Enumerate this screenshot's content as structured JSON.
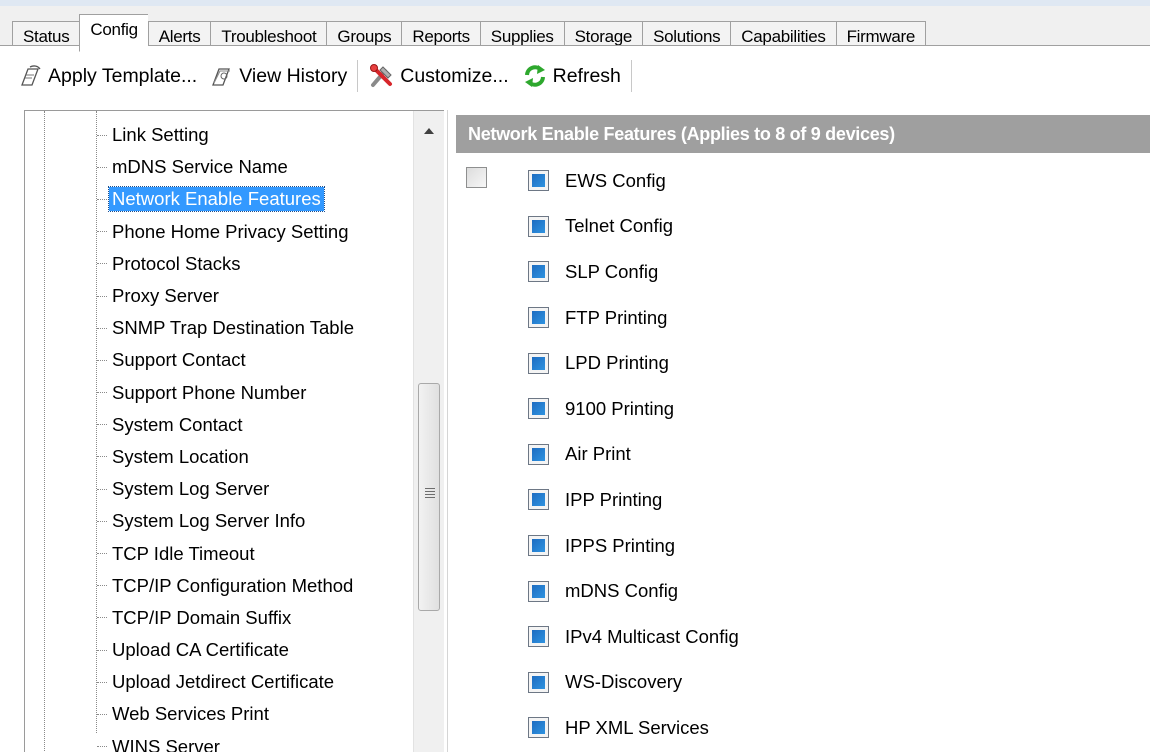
{
  "tabs": [
    "Status",
    "Config",
    "Alerts",
    "Troubleshoot",
    "Groups",
    "Reports",
    "Supplies",
    "Storage",
    "Solutions",
    "Capabilities",
    "Firmware"
  ],
  "active_tab": "Config",
  "toolbar": {
    "apply_template": "Apply Template...",
    "view_history": "View History",
    "customize": "Customize...",
    "refresh": "Refresh"
  },
  "tree": {
    "items": [
      "Link Setting",
      "mDNS Service Name",
      "Network Enable Features",
      "Phone Home Privacy Setting",
      "Protocol Stacks",
      "Proxy Server",
      "SNMP Trap Destination Table",
      "Support Contact",
      "Support Phone Number",
      "System Contact",
      "System Location",
      "System Log Server",
      "System Log Server Info",
      "TCP Idle Timeout",
      "TCP/IP Configuration Method",
      "TCP/IP Domain Suffix",
      "Upload CA Certificate",
      "Upload Jetdirect Certificate",
      "Web Services Print",
      "WINS Server"
    ],
    "selected": "Network Enable Features"
  },
  "panel": {
    "title": "Network Enable Features  (Applies to 8 of 9 devices)",
    "features": [
      "EWS Config",
      "Telnet Config",
      "SLP Config",
      "FTP Printing",
      "LPD Printing",
      "9100 Printing",
      "Air Print",
      "IPP Printing",
      "IPPS Printing",
      "mDNS Config",
      "IPv4 Multicast Config",
      "WS-Discovery",
      "HP XML Services"
    ]
  },
  "colors": {
    "selection": "#3399ff",
    "header": "#9f9f9f",
    "indeterminate": "#1d6cc1"
  }
}
